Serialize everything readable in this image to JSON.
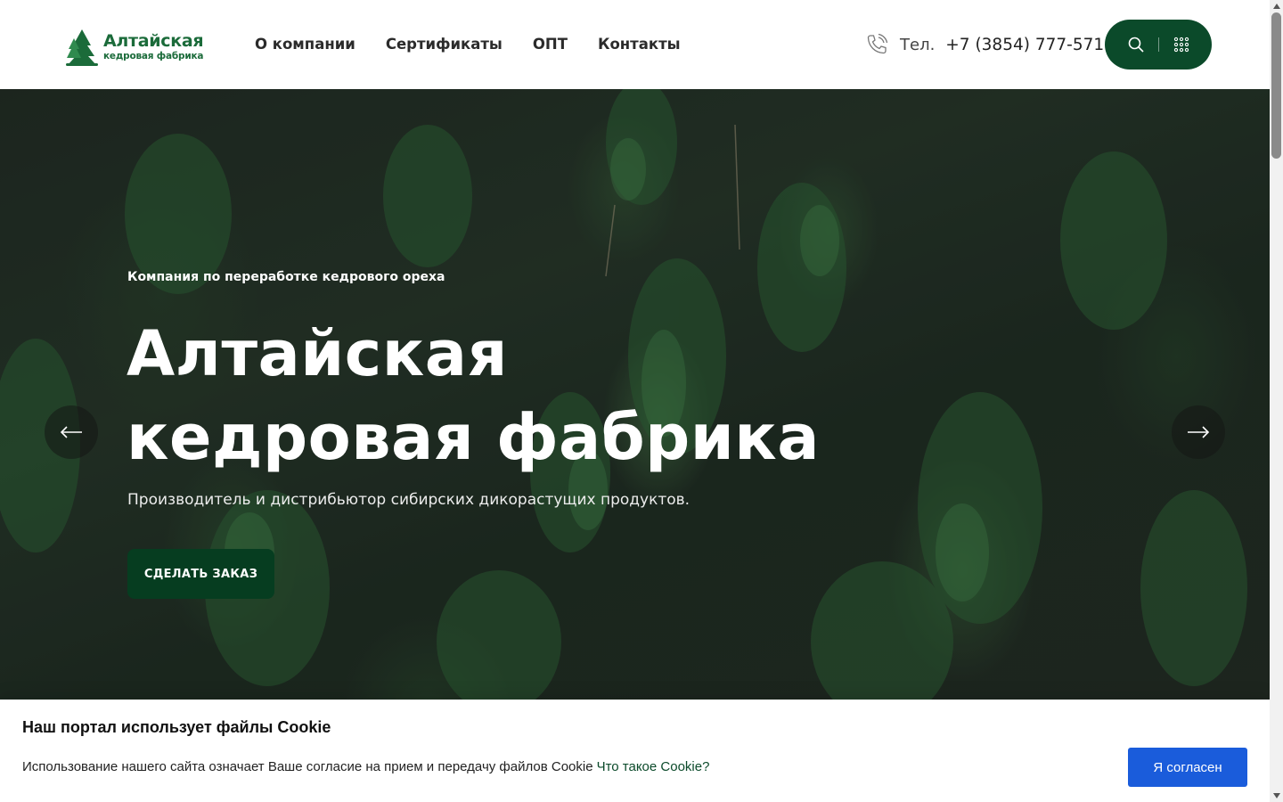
{
  "header": {
    "logo": {
      "title": "Алтайская",
      "subtitle": "кедровая фабрика",
      "icon": "fir-tree-logo-icon"
    },
    "nav": [
      {
        "label": "О компании"
      },
      {
        "label": "Сертификаты"
      },
      {
        "label": "ОПТ"
      },
      {
        "label": "Контакты"
      }
    ],
    "phone": {
      "label": "Тел.",
      "number": "+7 (3854) 777-571",
      "icon": "phone-icon"
    },
    "tools": {
      "search_icon": "search-icon",
      "menu_icon": "grid-menu-icon"
    }
  },
  "hero": {
    "kicker": "Компания по переработке кедрового ореха",
    "title_line1": "Алтайская",
    "title_line2": "кедровая фабрика",
    "description": "Производитель и дистрибьютор сибирских дикорастущих продуктов.",
    "cta": "СДЕЛАТЬ ЗАКАЗ",
    "prev_icon": "arrow-left-icon",
    "next_icon": "arrow-right-icon"
  },
  "cookie": {
    "title": "Наш портал использует файлы Cookie",
    "text": "Использование нашего сайта означает Ваше согласие на прием и передачу файлов Cookie",
    "link": "Что такое Cookie?",
    "accept": "Я согласен"
  },
  "colors": {
    "brand_green": "#0b4a2a",
    "cta_green": "#063d20",
    "logo_green": "#1b6b3a",
    "cookie_button": "#1a5cdb"
  }
}
